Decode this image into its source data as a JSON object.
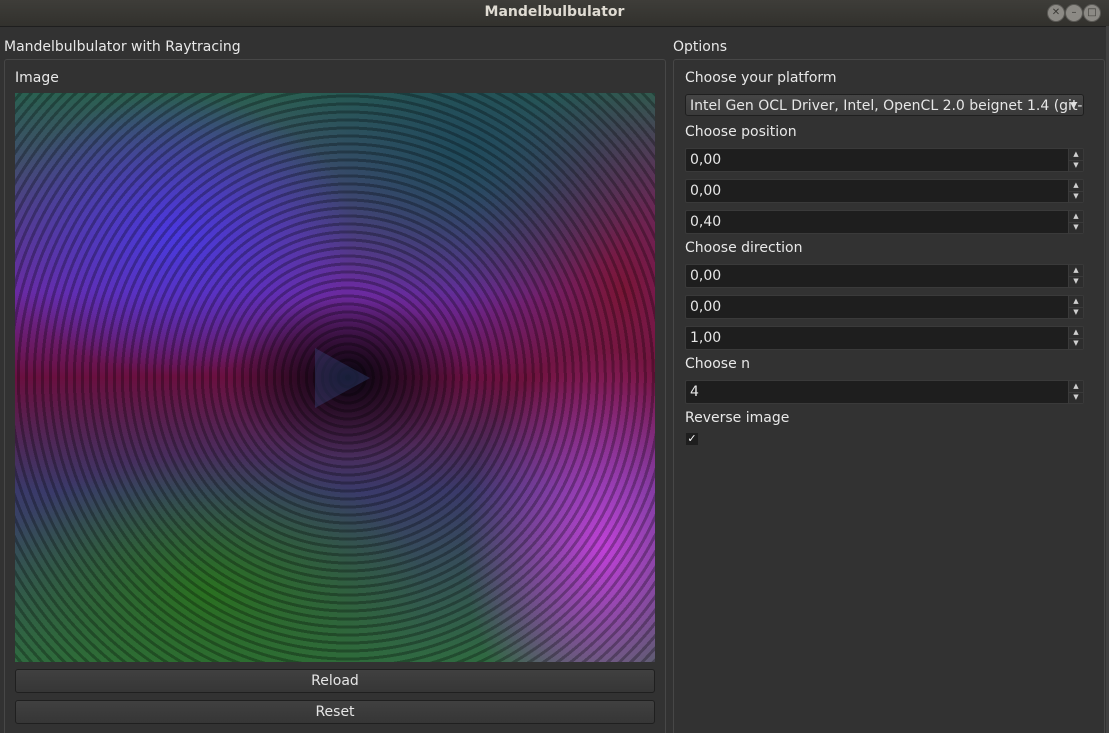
{
  "window": {
    "title": "Mandelbulbulator",
    "controls": [
      "close-icon",
      "minimize-icon",
      "maximize-icon"
    ]
  },
  "left": {
    "section_label": "Mandelbulbulator with Raytracing",
    "group_label": "Image",
    "reload_label": "Reload",
    "reset_label": "Reset"
  },
  "options": {
    "section_label": "Options",
    "platform_label": "Choose your platform",
    "platform_value": "Intel Gen OCL Driver, Intel, OpenCL 2.0 beignet 1.4 (git-",
    "position_label": "Choose position",
    "position": [
      "0,00",
      "0,00",
      "0,40"
    ],
    "direction_label": "Choose direction",
    "direction": [
      "0,00",
      "0,00",
      "1,00"
    ],
    "n_label": "Choose n",
    "n_value": "4",
    "reverse_label": "Reverse image",
    "reverse_checked": true,
    "reverse_check_glyph": "✓"
  }
}
